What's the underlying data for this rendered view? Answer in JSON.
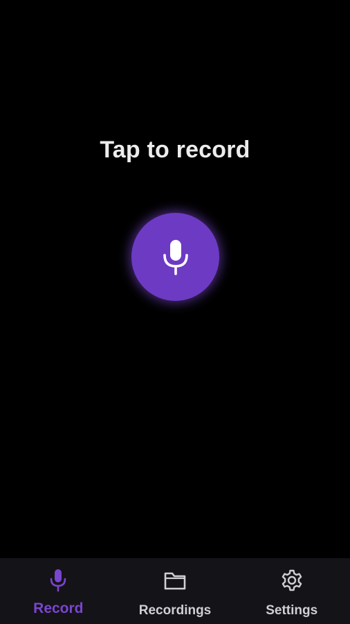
{
  "main": {
    "prompt": "Tap to record",
    "record_button": {
      "icon": "microphone-icon",
      "color": "#6d3ac4"
    }
  },
  "bottom_nav": {
    "active_color": "#7a45cf",
    "inactive_color": "#cfcfd4",
    "items": [
      {
        "label": "Record",
        "icon": "microphone-icon",
        "active": true
      },
      {
        "label": "Recordings",
        "icon": "folder-icon",
        "active": false
      },
      {
        "label": "Settings",
        "icon": "gear-icon",
        "active": false
      }
    ]
  }
}
